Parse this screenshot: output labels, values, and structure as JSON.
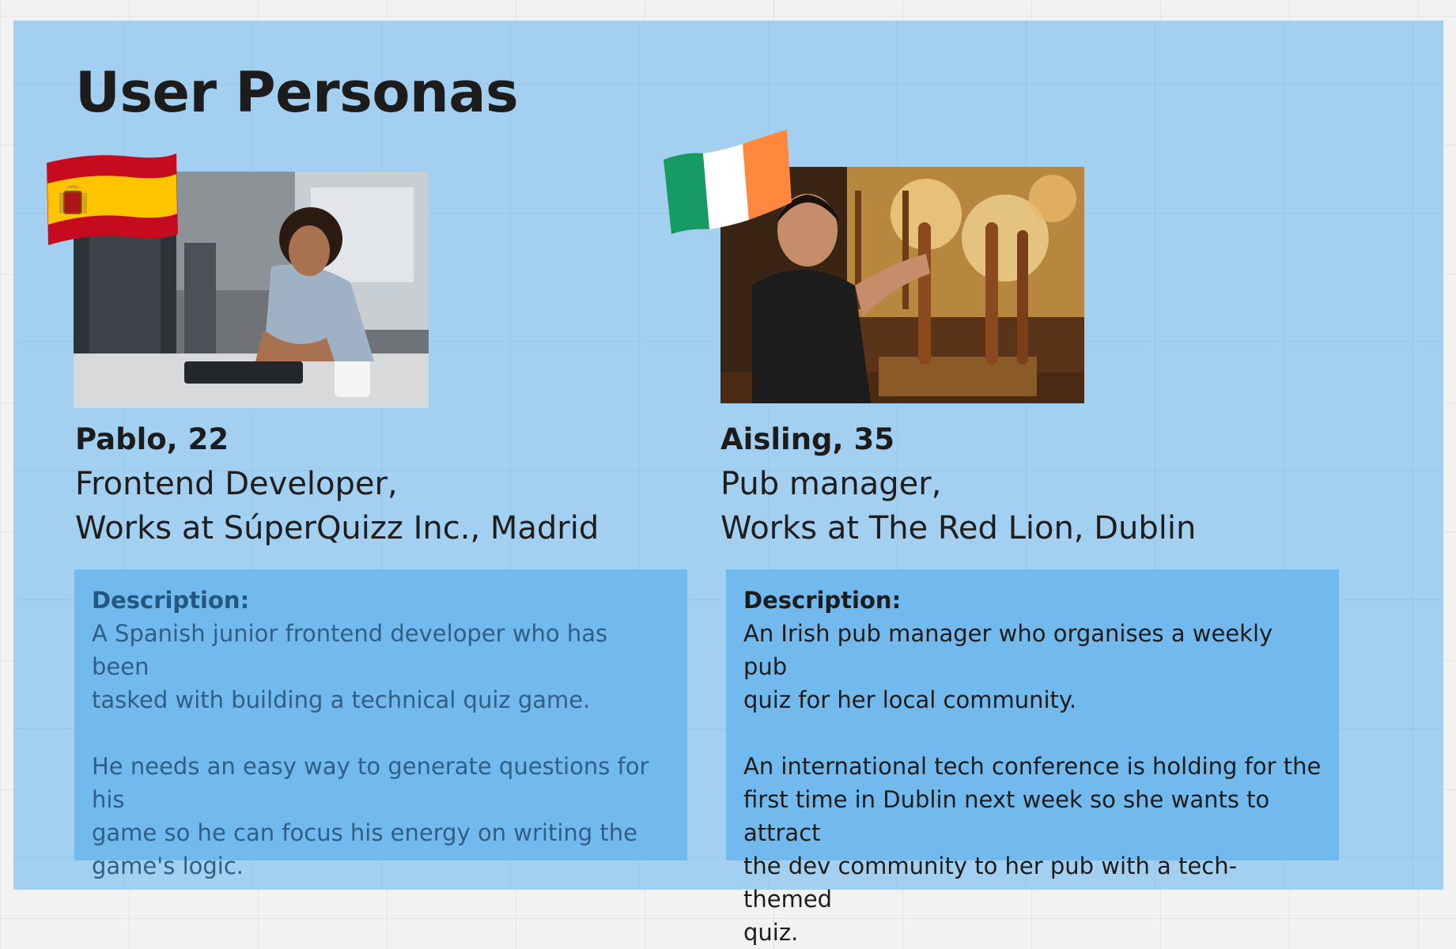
{
  "board": {
    "title": "User Personas"
  },
  "personas": [
    {
      "flag_icon": "spain-flag-icon",
      "photo_icon": "developer-photo",
      "name": "Pablo, 22",
      "role_line1": "Frontend Developer,",
      "role_line2": "Works at SúperQuizz Inc., Madrid",
      "description_heading": "Description:",
      "description_paragraphs": [
        "A Spanish junior frontend developer who has been tasked with building a technical quiz game.",
        "He needs an easy way to generate questions for his game so he can focus his energy on writing the game's logic."
      ],
      "description_lines": [
        "A Spanish junior frontend developer who has been",
        "tasked with building a technical quiz game.",
        "He needs an easy way to generate questions for his",
        "game so he can focus his energy on writing the",
        "game's logic."
      ]
    },
    {
      "flag_icon": "ireland-flag-icon",
      "photo_icon": "pub-manager-photo",
      "name": "Aisling, 35",
      "role_line1": "Pub manager,",
      "role_line2": "Works at The Red Lion, Dublin",
      "description_heading": "Description:",
      "description_paragraphs": [
        "An Irish pub manager who organises a weekly pub quiz for her local community.",
        "An international tech conference is holding for the first time in Dublin next week so she wants to attract the dev community to her pub with a tech-themed quiz."
      ],
      "description_lines": [
        "An Irish pub manager who organises a weekly pub",
        "quiz for her local community.",
        "An international tech conference is holding for the",
        "first time in Dublin next week so she wants to attract",
        "the dev community to her pub with a tech-themed",
        "quiz."
      ]
    }
  ],
  "colors": {
    "canvas_background": "#f2f2f2",
    "frame_background": "#a3cff0",
    "description_box": "#72b9ed",
    "text_dark": "#1c1c1c",
    "text_muted": "#2f5f87",
    "spain_red": "#c60b1e",
    "spain_yellow": "#ffc400",
    "ireland_green": "#169b62",
    "ireland_white": "#ffffff",
    "ireland_orange": "#ff883e"
  }
}
